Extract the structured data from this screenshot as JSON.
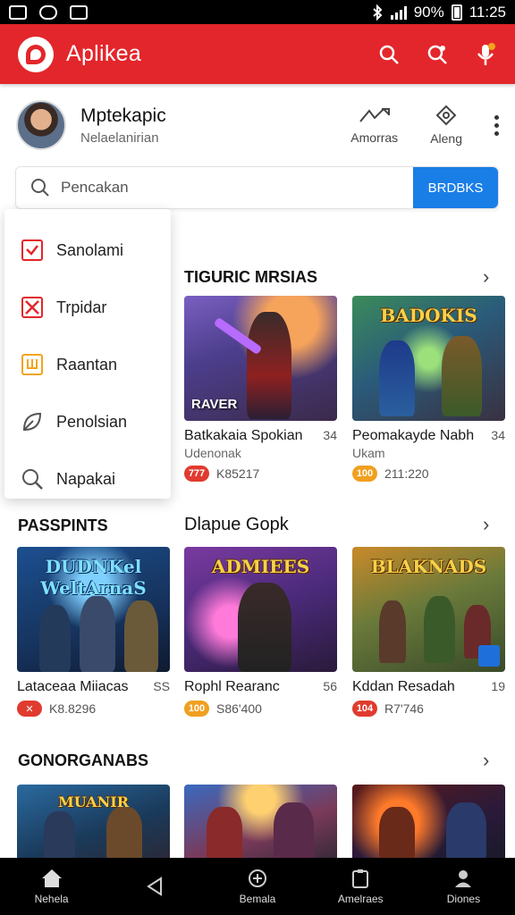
{
  "status_bar": {
    "battery_pct": "90%",
    "time": "11:25"
  },
  "app_bar": {
    "title": "Aplikea"
  },
  "profile": {
    "name": "Mptekapic",
    "subtitle": "Nelaelanirian",
    "action1_label": "Amorras",
    "action2_label": "Aleng"
  },
  "search": {
    "placeholder": "Pencakan",
    "button_label": "BRDBKS"
  },
  "menu": {
    "items": [
      {
        "label": "Sanolami",
        "icon": "checkbox-icon"
      },
      {
        "label": "Trpidar",
        "icon": "x-box-icon"
      },
      {
        "label": "Raantan",
        "icon": "calendar-icon"
      },
      {
        "label": "Penolsian",
        "icon": "leaf-icon"
      },
      {
        "label": "Napakai",
        "icon": "search-icon"
      }
    ]
  },
  "sections": {
    "s1": {
      "title": "TIGURIC MRSIAS"
    },
    "s2": {
      "title": "PASSPINTS",
      "title2": "Dlapue Gopk"
    },
    "s3": {
      "title": "GONORGANABS"
    }
  },
  "cards": [
    {
      "art_title": "",
      "art_sub": "RAVER",
      "title": "Batkakaia Spokian",
      "count": "34",
      "subtitle": "Udenonak",
      "badge": "777",
      "stat": "K85217",
      "badge_color": "#e03b2f"
    },
    {
      "art_title": "BADOKIS",
      "art_sub": "",
      "title": "Peomakayde Nabh",
      "count": "34",
      "subtitle": "Ukam",
      "badge": "100",
      "stat": "211:220",
      "badge_color": "#f0a020"
    },
    {
      "art_title": "DUDNKel WeltArnaS",
      "art_sub": "",
      "title": "Lataceaa Miiacas",
      "count": "SS",
      "subtitle": "",
      "badge": "✕",
      "stat": "K8.8296",
      "badge_color": "#e03b2f"
    },
    {
      "art_title": "ADMIEES",
      "art_sub": "",
      "title": "Rophl Rearanc",
      "count": "56",
      "subtitle": "",
      "badge": "100",
      "stat": "S86'400",
      "badge_color": "#f0a020"
    },
    {
      "art_title": "BLAKNADS",
      "art_sub": "",
      "title": "Kddan Resadah",
      "count": "19",
      "subtitle": "",
      "badge": "104",
      "stat": "R7'746",
      "badge_color": "#e03b2f"
    },
    {
      "art_title": "MUANIR",
      "art_sub": "",
      "title": "",
      "count": "",
      "subtitle": "",
      "badge": "",
      "stat": ""
    },
    {
      "art_title": "",
      "art_sub": "",
      "title": "",
      "count": "",
      "subtitle": "",
      "badge": "",
      "stat": ""
    },
    {
      "art_title": "",
      "art_sub": "",
      "title": "",
      "count": "",
      "subtitle": "",
      "badge": "",
      "stat": ""
    }
  ],
  "bottom_nav": [
    {
      "label": "Nehela",
      "icon": "home-icon"
    },
    {
      "label": "",
      "icon": "back-icon"
    },
    {
      "label": "Bemala",
      "icon": "gamepad-icon"
    },
    {
      "label": "Amelraes",
      "icon": "clipboard-icon"
    },
    {
      "label": "Diones",
      "icon": "person-icon"
    }
  ]
}
